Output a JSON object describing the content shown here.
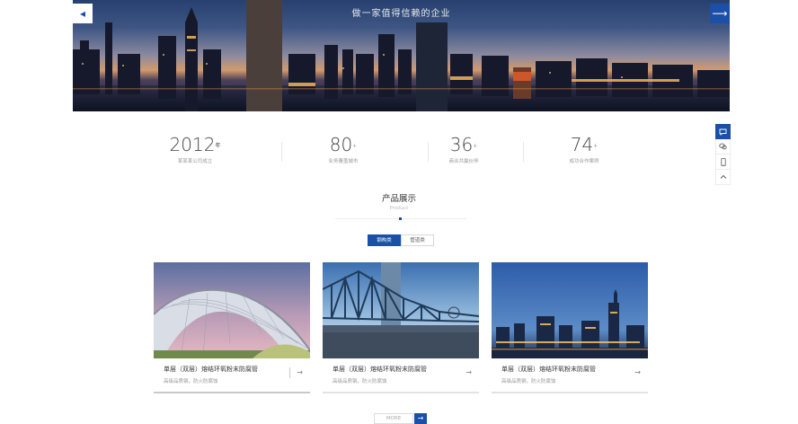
{
  "hero": {
    "slogan": "做一家值得信赖的企业",
    "prev_icon": "arrow-left-icon",
    "next_icon": "arrow-right-icon"
  },
  "stats": [
    {
      "value": "2012",
      "unit": "年",
      "label": "某某某公司成立"
    },
    {
      "value": "80",
      "unit": "+",
      "label": "业务覆盖城市"
    },
    {
      "value": "36",
      "unit": "+",
      "label": "商业共赢伙伴"
    },
    {
      "value": "74",
      "unit": "+",
      "label": "成功合作案例"
    }
  ],
  "section": {
    "title": "产品展示",
    "subtitle": "Product"
  },
  "tabs": [
    {
      "label": "钢构类",
      "active": true
    },
    {
      "label": "管道类",
      "active": false
    }
  ],
  "cards": [
    {
      "title": "单层（双层）熔结环氧粉末防腐管",
      "desc": "高级品质钢，防火防腐蚀"
    },
    {
      "title": "单层（双层）熔结环氧粉末防腐管",
      "desc": "高级品质钢，防火防腐蚀"
    },
    {
      "title": "单层（双层）熔结环氧粉末防腐管",
      "desc": "高级品质钢，防火防腐蚀"
    }
  ],
  "more": {
    "label": "MORE"
  },
  "sidebar": [
    {
      "icon": "chat-icon"
    },
    {
      "icon": "wechat-icon"
    },
    {
      "icon": "mobile-icon"
    },
    {
      "icon": "chevron-up-icon"
    }
  ],
  "colors": {
    "accent": "#1b4fa8"
  }
}
